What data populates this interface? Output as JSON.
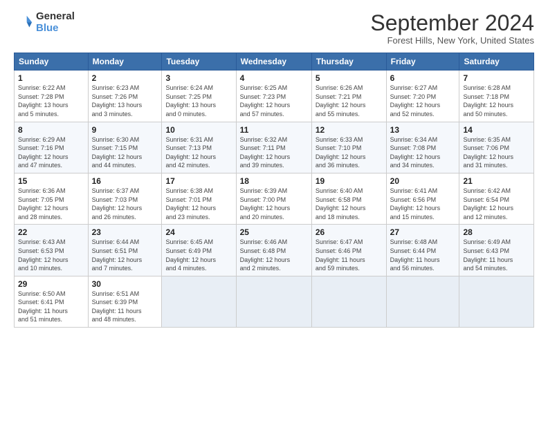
{
  "header": {
    "logo_general": "General",
    "logo_blue": "Blue",
    "month_title": "September 2024",
    "location": "Forest Hills, New York, United States"
  },
  "days_of_week": [
    "Sunday",
    "Monday",
    "Tuesday",
    "Wednesday",
    "Thursday",
    "Friday",
    "Saturday"
  ],
  "weeks": [
    [
      {
        "day": "1",
        "info": "Sunrise: 6:22 AM\nSunset: 7:28 PM\nDaylight: 13 hours\nand 5 minutes."
      },
      {
        "day": "2",
        "info": "Sunrise: 6:23 AM\nSunset: 7:26 PM\nDaylight: 13 hours\nand 3 minutes."
      },
      {
        "day": "3",
        "info": "Sunrise: 6:24 AM\nSunset: 7:25 PM\nDaylight: 13 hours\nand 0 minutes."
      },
      {
        "day": "4",
        "info": "Sunrise: 6:25 AM\nSunset: 7:23 PM\nDaylight: 12 hours\nand 57 minutes."
      },
      {
        "day": "5",
        "info": "Sunrise: 6:26 AM\nSunset: 7:21 PM\nDaylight: 12 hours\nand 55 minutes."
      },
      {
        "day": "6",
        "info": "Sunrise: 6:27 AM\nSunset: 7:20 PM\nDaylight: 12 hours\nand 52 minutes."
      },
      {
        "day": "7",
        "info": "Sunrise: 6:28 AM\nSunset: 7:18 PM\nDaylight: 12 hours\nand 50 minutes."
      }
    ],
    [
      {
        "day": "8",
        "info": "Sunrise: 6:29 AM\nSunset: 7:16 PM\nDaylight: 12 hours\nand 47 minutes."
      },
      {
        "day": "9",
        "info": "Sunrise: 6:30 AM\nSunset: 7:15 PM\nDaylight: 12 hours\nand 44 minutes."
      },
      {
        "day": "10",
        "info": "Sunrise: 6:31 AM\nSunset: 7:13 PM\nDaylight: 12 hours\nand 42 minutes."
      },
      {
        "day": "11",
        "info": "Sunrise: 6:32 AM\nSunset: 7:11 PM\nDaylight: 12 hours\nand 39 minutes."
      },
      {
        "day": "12",
        "info": "Sunrise: 6:33 AM\nSunset: 7:10 PM\nDaylight: 12 hours\nand 36 minutes."
      },
      {
        "day": "13",
        "info": "Sunrise: 6:34 AM\nSunset: 7:08 PM\nDaylight: 12 hours\nand 34 minutes."
      },
      {
        "day": "14",
        "info": "Sunrise: 6:35 AM\nSunset: 7:06 PM\nDaylight: 12 hours\nand 31 minutes."
      }
    ],
    [
      {
        "day": "15",
        "info": "Sunrise: 6:36 AM\nSunset: 7:05 PM\nDaylight: 12 hours\nand 28 minutes."
      },
      {
        "day": "16",
        "info": "Sunrise: 6:37 AM\nSunset: 7:03 PM\nDaylight: 12 hours\nand 26 minutes."
      },
      {
        "day": "17",
        "info": "Sunrise: 6:38 AM\nSunset: 7:01 PM\nDaylight: 12 hours\nand 23 minutes."
      },
      {
        "day": "18",
        "info": "Sunrise: 6:39 AM\nSunset: 7:00 PM\nDaylight: 12 hours\nand 20 minutes."
      },
      {
        "day": "19",
        "info": "Sunrise: 6:40 AM\nSunset: 6:58 PM\nDaylight: 12 hours\nand 18 minutes."
      },
      {
        "day": "20",
        "info": "Sunrise: 6:41 AM\nSunset: 6:56 PM\nDaylight: 12 hours\nand 15 minutes."
      },
      {
        "day": "21",
        "info": "Sunrise: 6:42 AM\nSunset: 6:54 PM\nDaylight: 12 hours\nand 12 minutes."
      }
    ],
    [
      {
        "day": "22",
        "info": "Sunrise: 6:43 AM\nSunset: 6:53 PM\nDaylight: 12 hours\nand 10 minutes."
      },
      {
        "day": "23",
        "info": "Sunrise: 6:44 AM\nSunset: 6:51 PM\nDaylight: 12 hours\nand 7 minutes."
      },
      {
        "day": "24",
        "info": "Sunrise: 6:45 AM\nSunset: 6:49 PM\nDaylight: 12 hours\nand 4 minutes."
      },
      {
        "day": "25",
        "info": "Sunrise: 6:46 AM\nSunset: 6:48 PM\nDaylight: 12 hours\nand 2 minutes."
      },
      {
        "day": "26",
        "info": "Sunrise: 6:47 AM\nSunset: 6:46 PM\nDaylight: 11 hours\nand 59 minutes."
      },
      {
        "day": "27",
        "info": "Sunrise: 6:48 AM\nSunset: 6:44 PM\nDaylight: 11 hours\nand 56 minutes."
      },
      {
        "day": "28",
        "info": "Sunrise: 6:49 AM\nSunset: 6:43 PM\nDaylight: 11 hours\nand 54 minutes."
      }
    ],
    [
      {
        "day": "29",
        "info": "Sunrise: 6:50 AM\nSunset: 6:41 PM\nDaylight: 11 hours\nand 51 minutes."
      },
      {
        "day": "30",
        "info": "Sunrise: 6:51 AM\nSunset: 6:39 PM\nDaylight: 11 hours\nand 48 minutes."
      },
      {
        "day": "",
        "info": ""
      },
      {
        "day": "",
        "info": ""
      },
      {
        "day": "",
        "info": ""
      },
      {
        "day": "",
        "info": ""
      },
      {
        "day": "",
        "info": ""
      }
    ]
  ]
}
